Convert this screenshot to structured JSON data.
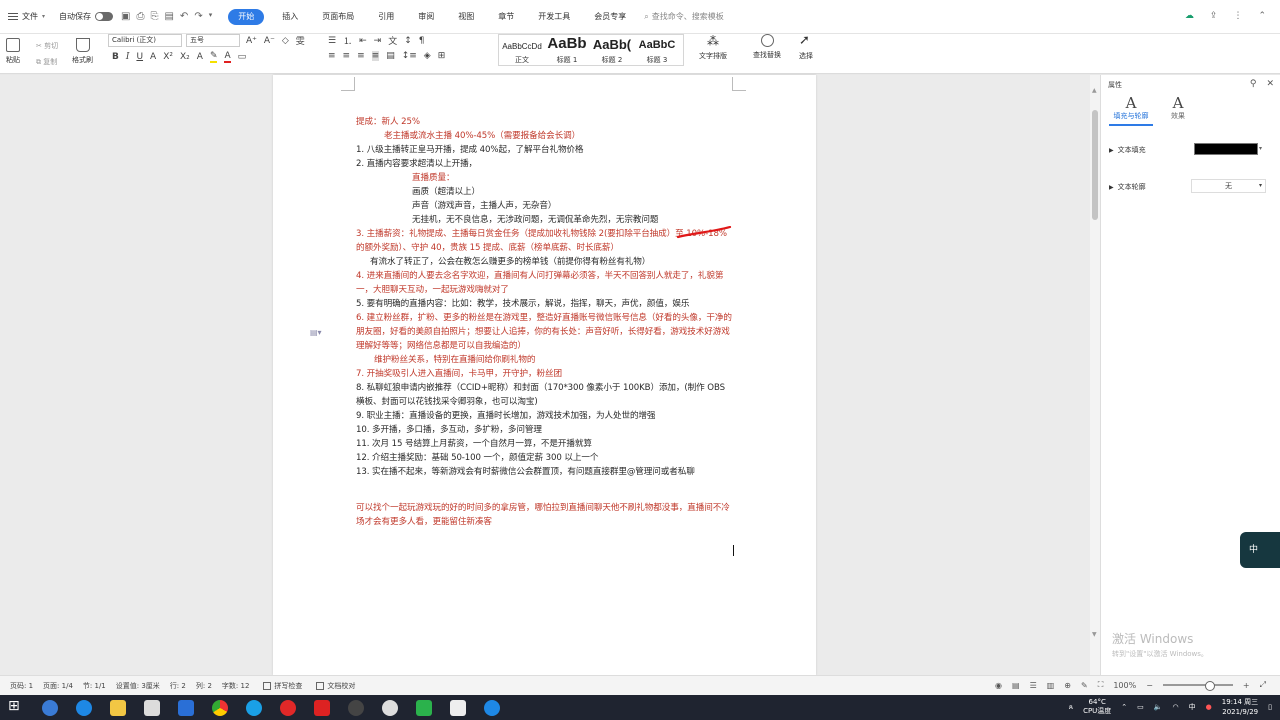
{
  "menubar": {
    "file": "文件",
    "autosave": "自动保存",
    "tabs": [
      "开始",
      "插入",
      "页面布局",
      "引用",
      "审阅",
      "视图",
      "章节",
      "开发工具",
      "会员专享"
    ],
    "search_placeholder": "查找命令、搜索模板"
  },
  "ribbon": {
    "paste": "粘贴",
    "cut": "剪切",
    "copy": "复制",
    "format_painter": "格式刷",
    "font_name": "Calibri (正文)",
    "font_size": "五号",
    "styles": [
      {
        "preview": "AaBbCcDd",
        "label": "正文"
      },
      {
        "preview": "AaBb",
        "label": "标题 1"
      },
      {
        "preview": "AaBb(",
        "label": "标题 2"
      },
      {
        "preview": "AaBbC",
        "label": "标题 3"
      }
    ],
    "text_layout": "文字排版",
    "find_replace": "查找替换",
    "select": "选择"
  },
  "document": {
    "lines": [
      {
        "t": "提成：新人 25%",
        "c": "red",
        "i": ""
      },
      {
        "t": "老主播或流水主播 40%-45%（需要报备给会长调）",
        "c": "red",
        "i": "ind1"
      },
      {
        "t": "1.  八级主播转正皇马开播，提成 40%起，了解平台礼物价格",
        "c": "",
        "i": ""
      },
      {
        "t": "2.  直播内容要求超清以上开播，",
        "c": "",
        "i": ""
      },
      {
        "t": "直播质量：",
        "c": "red",
        "i": "ind2"
      },
      {
        "t": "画质（超清以上）",
        "c": "",
        "i": "ind2"
      },
      {
        "t": "声音（游戏声音，主播人声，无杂音）",
        "c": "",
        "i": "ind2"
      },
      {
        "t": "无挂机，无不良信息，无涉政问题，无调侃革命先烈，无宗教问题",
        "c": "",
        "i": "ind2"
      },
      {
        "t": "3.  主播薪资：礼物提成、主播每日赏金任务（提成加收礼物钱除 2(要扣除平台抽成）至 10%-18%的额外奖励）、守护 40，贵族 15 提成、底薪（榜单底薪、时长底薪）",
        "c": "red",
        "i": ""
      },
      {
        "t": "有流水了转正了，公会在教怎么赚更多的榜单钱（前提你得有粉丝有礼物）",
        "c": "",
        "i": "ind3"
      },
      {
        "t": "4.  进来直播间的人要去念名字欢迎，直播间有人问打弹幕必须答，半天不回答别人就走了，礼貌第一，大胆聊天互动，一起玩游戏嗨就对了",
        "c": "red",
        "i": ""
      },
      {
        "t": "5.  要有明确的直播内容：比如：教学，技术展示，解说，指挥，聊天，声优，颜值，娱乐",
        "c": "",
        "i": ""
      },
      {
        "t": "6.  建立粉丝群，扩粉、更多的粉丝是在游戏里，整造好直播账号微信账号信息（好看的头像，干净的朋友圈，好看的美颜自拍照片；想要让人追捧，你的有长处：声音好听，长得好看，游戏技术好游戏理解好等等；网络信息都是可以自我编造的）",
        "c": "red",
        "i": ""
      },
      {
        "t": "维护粉丝关系，特别在直播间给你刷礼物的",
        "c": "red",
        "i": "ind4"
      },
      {
        "t": "7.  开抽奖吸引人进入直播间，卡马甲，开守护，粉丝团",
        "c": "red",
        "i": ""
      },
      {
        "t": "8.  私聊虹狼申请内嵌推荐（CCID+昵称）和封面（170*300 像素小于 100KB）添加，(制作 OBS 横板、封面可以花钱找采令卿羽象，也可以淘宝)",
        "c": "",
        "i": ""
      },
      {
        "t": "9.  职业主播：直播设备的更换，直播时长增加，游戏技术加强，为人处世的增强",
        "c": "",
        "i": ""
      },
      {
        "t": "10. 多开播，多口播，多互动，多扩粉，多问管理",
        "c": "",
        "i": ""
      },
      {
        "t": "11. 次月 15 号结算上月薪资，一个自然月一算，不是开播就算",
        "c": "",
        "i": ""
      },
      {
        "t": "12. 介绍主播奖励：基础 50-100 一个，颜值定薪 300 以上一个",
        "c": "",
        "i": ""
      },
      {
        "t": "13. 实在播不起来，等新游戏会有时薪微信公会群置顶，有问题直接群里@管理问或者私聊",
        "c": "",
        "i": ""
      }
    ],
    "closing": "可以找个一起玩游戏玩的好的时间多的拿房管，哪怕拉到直播间聊天他不刷礼物都没事，直播间不冷场才会有更多人看，更能留住新凑客"
  },
  "properties_pane": {
    "title": "属性",
    "tab_fill": "填充与轮廓",
    "tab_effect": "效果",
    "text_fill": "文本填充",
    "text_outline": "文本轮廓",
    "outline_value": "无",
    "fill_color": "#000000",
    "activate_title": "激活 Windows",
    "activate_sub": "转到\"设置\"以激活 Windows。"
  },
  "ime": "中",
  "statusbar": {
    "page": "页码: 1",
    "pages": "页面: 1/4",
    "section": "节: 1/1",
    "setting": "设置值: 3厘米",
    "row": "行: 2",
    "col": "列: 2",
    "wordcount": "字数: 12",
    "spellcheck": "拼写检查",
    "proof": "文档校对",
    "zoom": "100%"
  },
  "taskbar": {
    "temp": "64°C",
    "temp_label": "CPU温度",
    "ime": "中",
    "time": "19:14 周三",
    "date": "2021/9/29"
  }
}
